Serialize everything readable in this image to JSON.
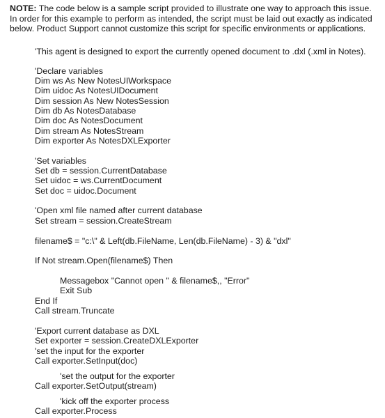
{
  "note": {
    "label": "NOTE:",
    "text": " The code below is a sample script provided to illustrate one way to approach this issue. In order for this example to perform as intended, the script must be laid out exactly as indicated below. Product Support cannot customize this script for specific environments or applications."
  },
  "code_lines": [
    {
      "text": "'This agent is designed to export the currently opened document to .dxl (.xml in Notes).",
      "indent": 1
    },
    {
      "text": "'Declare variables",
      "indent": 1
    },
    {
      "text": "Dim ws As New NotesUIWorkspace",
      "indent": 1
    },
    {
      "text": "Dim uidoc As NotesUIDocument",
      "indent": 1
    },
    {
      "text": "Dim session As New NotesSession",
      "indent": 1
    },
    {
      "text": "Dim db As NotesDatabase",
      "indent": 1
    },
    {
      "text": "Dim doc As NotesDocument",
      "indent": 1
    },
    {
      "text": "Dim stream As NotesStream",
      "indent": 1
    },
    {
      "text": "Dim exporter As NotesDXLExporter",
      "indent": 1
    },
    {
      "text": "'Set variables",
      "indent": 1
    },
    {
      "text": "Set db = session.CurrentDatabase",
      "indent": 1
    },
    {
      "text": "Set uidoc = ws.CurrentDocument",
      "indent": 1
    },
    {
      "text": "Set doc = uidoc.Document",
      "indent": 1
    },
    {
      "text": "'Open xml file named after current database",
      "indent": 1
    },
    {
      "text": "Set stream = session.CreateStream",
      "indent": 1
    },
    {
      "text": "filename$ = \"c:\\\" & Left(db.FileName, Len(db.FileName) - 3) & \"dxl\"",
      "indent": 1
    },
    {
      "text": "If Not stream.Open(filename$) Then",
      "indent": 1
    },
    {
      "text": "Messagebox \"Cannot open \" & filename$,, \"Error\"",
      "indent": 2
    },
    {
      "text": "Exit Sub",
      "indent": 2
    },
    {
      "text": "End If",
      "indent": 1
    },
    {
      "text": "Call stream.Truncate",
      "indent": 1
    },
    {
      "text": "'Export current database as DXL",
      "indent": 1
    },
    {
      "text": "Set exporter = session.CreateDXLExporter",
      "indent": 1
    },
    {
      "text": "'set the input for the exporter",
      "indent": 1
    },
    {
      "text": "Call exporter.SetInput(doc)",
      "indent": 1
    },
    {
      "text": "'set the output for the exporter",
      "indent": 2
    },
    {
      "text": "Call exporter.SetOutput(stream)",
      "indent": 1
    },
    {
      "text": "'kick off the exporter process",
      "indent": 2
    },
    {
      "text": "Call exporter.Process",
      "indent": 1
    }
  ]
}
